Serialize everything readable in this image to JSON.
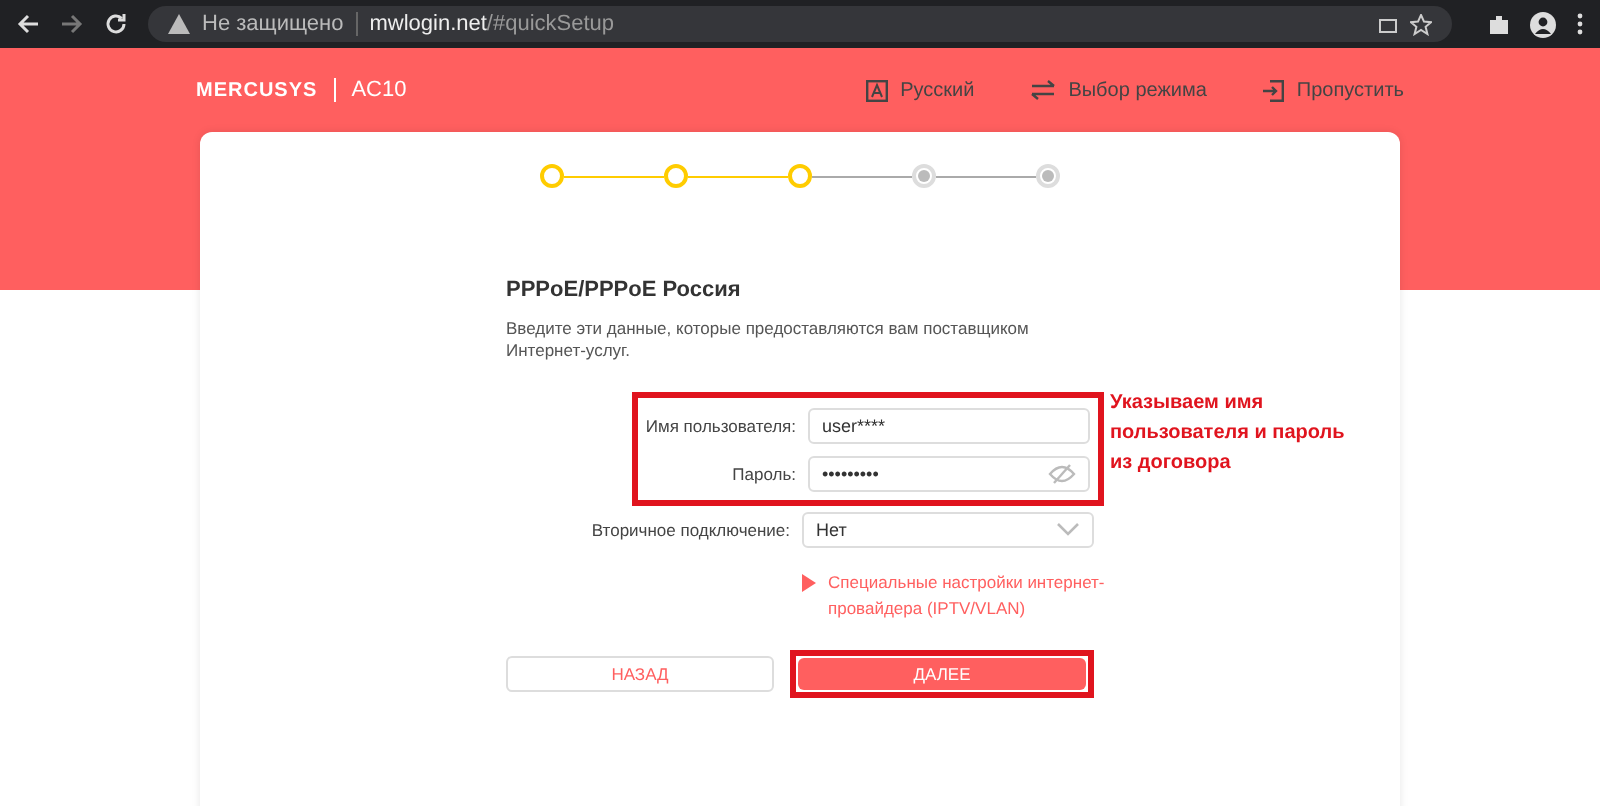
{
  "browser": {
    "security": "Не защищено",
    "url_host": "mwlogin.net",
    "url_path": "/#quickSetup"
  },
  "header": {
    "brand": "MERCUSYS",
    "model": "AC10",
    "links": [
      {
        "kind": "language",
        "label": "Русский"
      },
      {
        "kind": "mode",
        "label": "Выбор режима"
      },
      {
        "kind": "skip",
        "label": "Пропустить"
      }
    ]
  },
  "steps": [
    {
      "completed": true
    },
    {
      "completed": true
    },
    {
      "completed": true
    },
    {
      "completed": false
    },
    {
      "completed": false
    }
  ],
  "form": {
    "title": "PPPoE/PPPoE Россия",
    "description": "Введите эти данные, которые предоставляются вам поставщиком Интернет-услуг.",
    "fields": [
      {
        "kind": "text",
        "label": "Имя пользователя:",
        "value": "user****",
        "highlighted": true
      },
      {
        "kind": "password",
        "label": "Пароль:",
        "value": "•••••••••",
        "highlighted": true
      },
      {
        "kind": "select",
        "label": "Вторичное подключение:",
        "value": "Нет",
        "highlighted": false
      }
    ],
    "advanced_link": "Специальные настройки интернет-провайдера (IPTV/VLAN)",
    "back_button": "НАЗАД",
    "next_button": "ДАЛЕЕ"
  },
  "annotation": "Указываем имя пользователя и пароль из договора"
}
